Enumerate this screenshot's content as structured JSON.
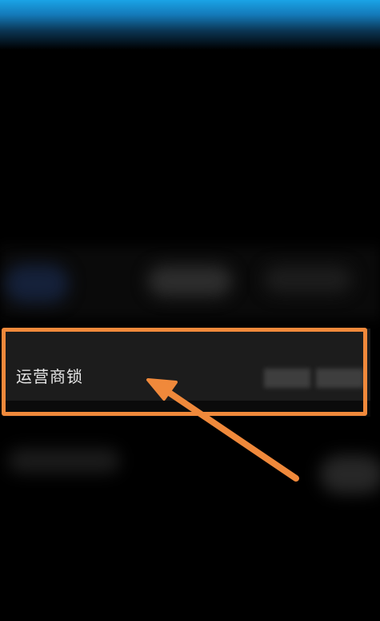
{
  "settings": {
    "carrier_lock": {
      "label": "运营商锁",
      "value_masked": true
    }
  },
  "annotation": {
    "highlight_color": "#f0893b",
    "arrow_color": "#f0893b"
  },
  "colors": {
    "background": "#000000",
    "row_background": "#1c1c1c",
    "label_text": "#e6e6e6",
    "top_glow": "#1aa3e6"
  }
}
